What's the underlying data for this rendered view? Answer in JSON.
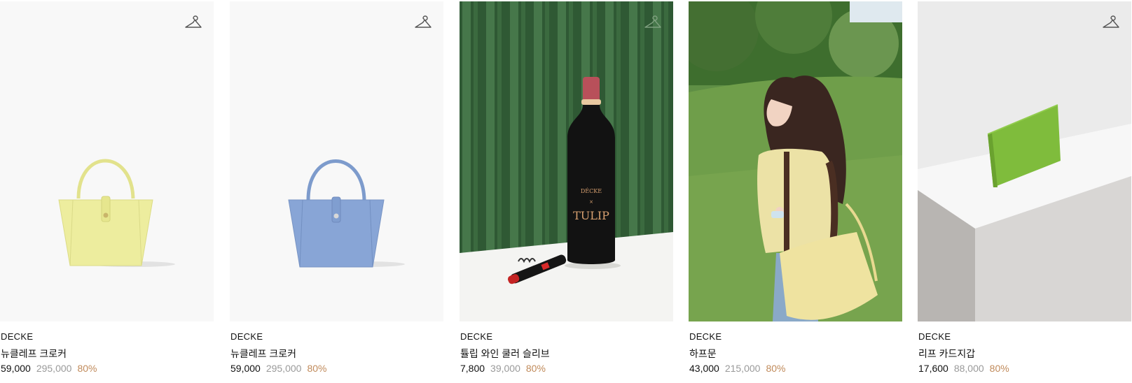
{
  "products": [
    {
      "brand": "DECKE",
      "name": "뉴클레프 크로커",
      "price": "59,000",
      "original_price": "295,000",
      "discount": "80%",
      "image": "yellow-tote-bag",
      "wishlist_icon": "hanger-icon"
    },
    {
      "brand": "DECKE",
      "name": "뉴클레프 크로커",
      "price": "59,000",
      "original_price": "295,000",
      "discount": "80%",
      "image": "blue-tote-bag",
      "wishlist_icon": "hanger-icon"
    },
    {
      "brand": "DECKE",
      "name": "튤립 와인 쿨러 슬리브",
      "price": "7,800",
      "original_price": "39,000",
      "discount": "80%",
      "image": "wine-cooler-sleeve",
      "wishlist_icon": "hanger-icon",
      "image_text": {
        "brand_mark": "DÉCKE",
        "x_mark": "×",
        "collab_mark": "TULIP"
      }
    },
    {
      "brand": "DECKE",
      "name": "하프문",
      "price": "43,000",
      "original_price": "215,000",
      "discount": "80%",
      "image": "model-with-halfmoon-bag"
    },
    {
      "brand": "DECKE",
      "name": "리프 카드지갑",
      "price": "17,600",
      "original_price": "88,000",
      "discount": "80%",
      "image": "green-card-wallet",
      "wishlist_icon": "hanger-icon"
    }
  ],
  "colors": {
    "discount": "#c08a5a",
    "original_price": "#9a9a9a",
    "text": "#111111"
  }
}
